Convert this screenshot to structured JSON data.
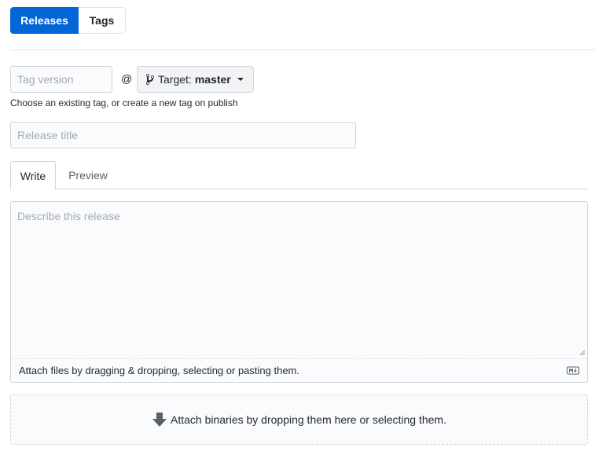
{
  "subnav": {
    "releases_label": "Releases",
    "tags_label": "Tags"
  },
  "tag": {
    "placeholder": "Tag version",
    "at_symbol": "@",
    "hint": "Choose an existing tag, or create a new tag on publish"
  },
  "target": {
    "label": "Target:",
    "value": "master"
  },
  "release_title": {
    "placeholder": "Release title"
  },
  "editor_tabs": {
    "write": "Write",
    "preview": "Preview"
  },
  "editor": {
    "placeholder": "Describe this release",
    "attach_hint": "Attach files by dragging & dropping, selecting or pasting them."
  },
  "dropzone": {
    "label": "Attach binaries by dropping them here or selecting them."
  },
  "colors": {
    "primary": "#0366d6",
    "border": "#d1d5da",
    "background_subtle": "#fafbfc",
    "text": "#24292e"
  },
  "icons": [
    "git-branch-icon",
    "caret-down-icon",
    "markdown-icon",
    "arrow-down-icon",
    "resize-grip-icon"
  ]
}
